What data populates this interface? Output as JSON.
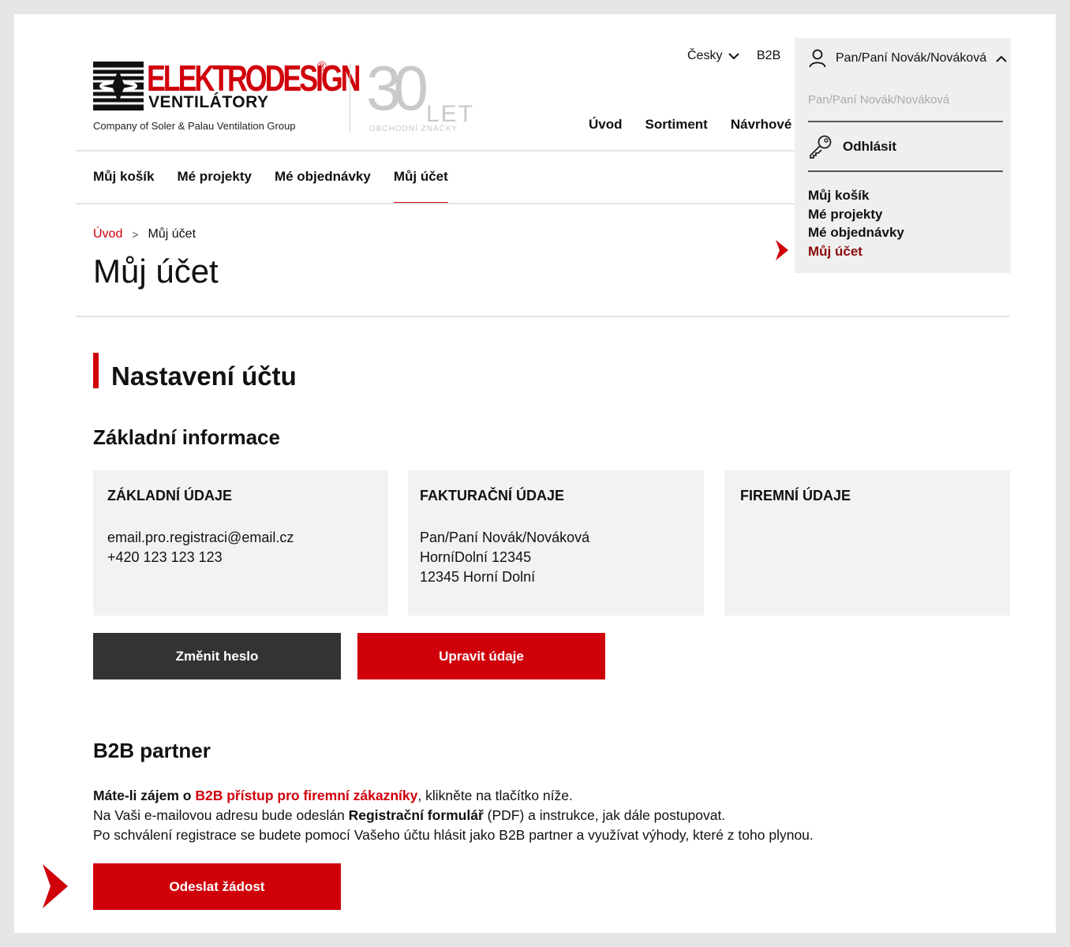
{
  "logo": {
    "brand": "ELEKTRODESIGN",
    "registered": "®",
    "subline": "VENTILÁTORY",
    "company": "Company of Soler & Palau Ventilation Group",
    "anniversary_number": "30",
    "anniversary_let": "LET",
    "anniversary_sub": "OBCHODNÍ ZNAČKY"
  },
  "top": {
    "language": "Česky",
    "b2b": "B2B"
  },
  "main_nav": [
    "Úvod",
    "Sortiment",
    "Návrhové"
  ],
  "sub_nav": [
    "Můj košík",
    "Mé projekty",
    "Mé objednávky",
    "Můj účet"
  ],
  "breadcrumb": {
    "home": "Úvod",
    "separator": ">",
    "current": "Můj účet"
  },
  "page_title": "Můj účet",
  "section_title": "Nastavení účtu",
  "subsection_title": "Základní informace",
  "cards": [
    {
      "title": "ZÁKLADNÍ ÚDAJE",
      "lines": [
        "email.pro.registraci@email.cz",
        "+420 123 123 123"
      ]
    },
    {
      "title": "FAKTURAČNÍ ÚDAJE",
      "lines": [
        "Pan/Paní Novák/Nováková",
        "HorníDolní 12345",
        "12345 Horní Dolní"
      ]
    },
    {
      "title": "FIREMNÍ ÚDAJE",
      "lines": []
    }
  ],
  "buttons": {
    "change_password": "Změnit heslo",
    "edit_details": "Upravit údaje",
    "send_request": "Odeslat žádost"
  },
  "b2b": {
    "title": "B2B partner",
    "line1_a": "Máte-li zájem o ",
    "line1_link": "B2B přístup pro firemní zákazníky",
    "line1_b": ", klikněte na tlačítko níže.",
    "line2_a": "Na Vaši e-mailovou adresu bude odeslán ",
    "line2_bold": "Registrační formulář",
    "line2_b": " (PDF) a instrukce, jak dále postupovat.",
    "line3": "Po schválení registrace se budete pomocí Vašeho účtu hlásit jako B2B partner a využívat výhody, které z toho plynou."
  },
  "dropdown": {
    "user": "Pan/Paní Novák/Nováková",
    "user_name": "Pan/Paní Novák/Nováková",
    "logout": "Odhlásit",
    "menu": [
      "Můj košík",
      "Mé projekty",
      "Mé objednávky",
      "Můj účet"
    ]
  },
  "colors": {
    "accent": "#d0000b",
    "dark_button": "#333333",
    "card_bg": "#f2f2f2",
    "dropdown_bg": "#efefef",
    "active_menu": "#8b0a0a"
  },
  "icons": [
    "user-icon",
    "chevron-up-icon",
    "chevron-down-icon",
    "key-icon",
    "chevron-right-icon"
  ]
}
